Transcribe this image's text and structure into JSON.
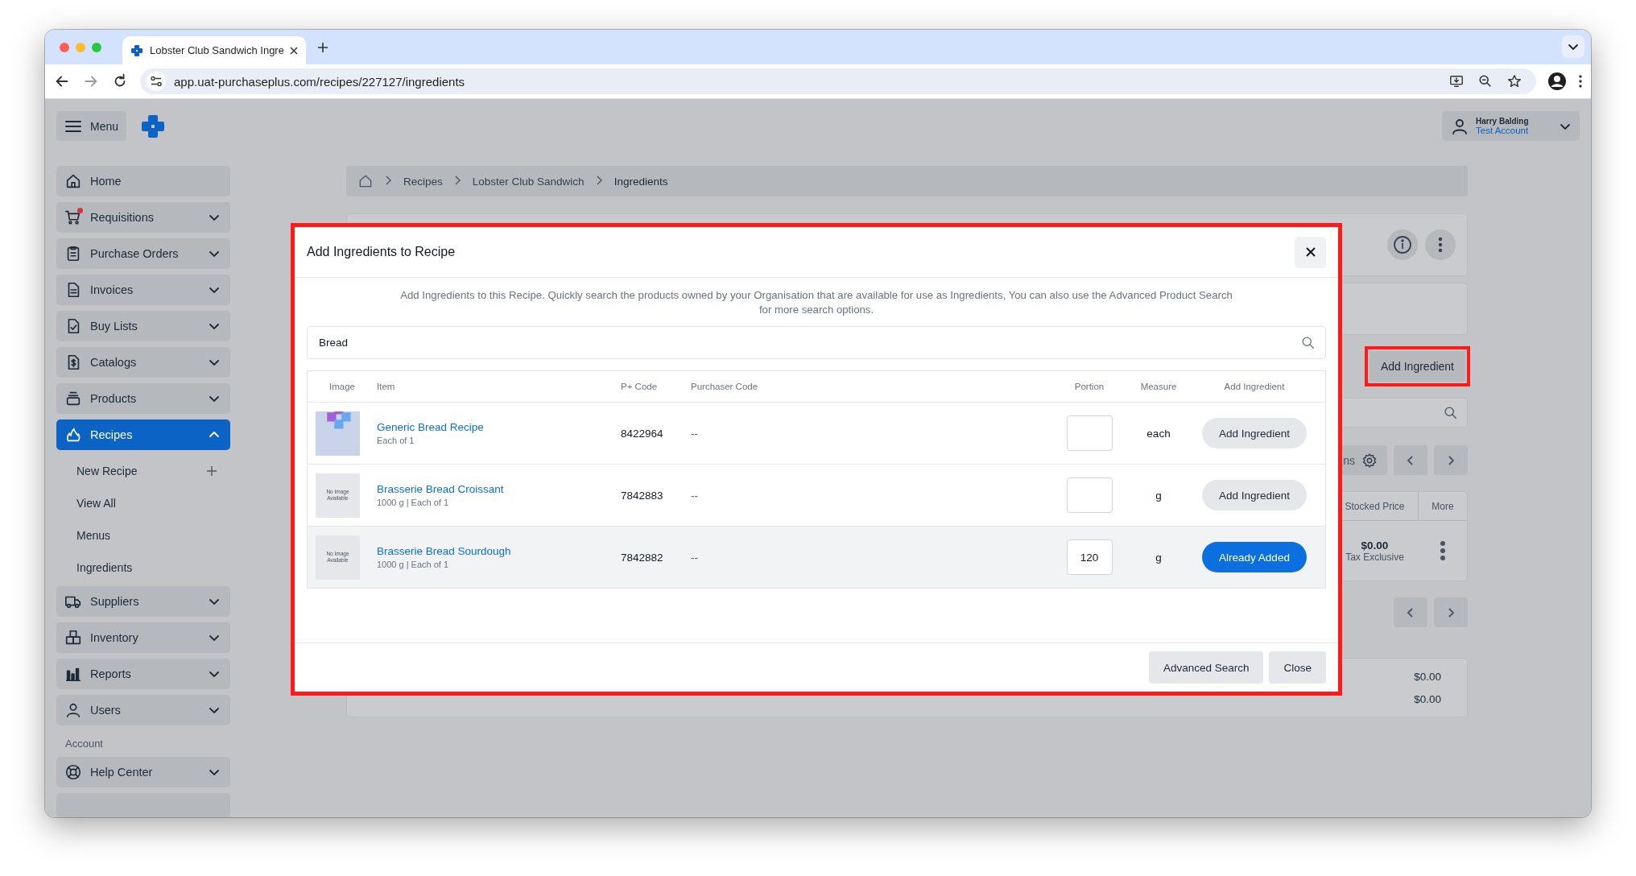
{
  "browser": {
    "tab_title": "Lobster Club Sandwich Ingre",
    "url": "app.uat-purchaseplus.com/recipes/227127/ingredients"
  },
  "header": {
    "menu_label": "Menu",
    "user_name": "Harry Balding",
    "account": "Test Account"
  },
  "sidebar": {
    "items": [
      {
        "label": "Home",
        "kind": "link",
        "selected": false
      },
      {
        "label": "Requisitions",
        "kind": "group",
        "selected": false,
        "expanded": false,
        "alert": true
      },
      {
        "label": "Purchase Orders",
        "kind": "group",
        "selected": false,
        "expanded": false,
        "alert": false
      },
      {
        "label": "Invoices",
        "kind": "group",
        "selected": false,
        "expanded": false,
        "alert": false
      },
      {
        "label": "Buy Lists",
        "kind": "group",
        "selected": false,
        "expanded": false,
        "alert": false
      },
      {
        "label": "Catalogs",
        "kind": "group",
        "selected": false,
        "expanded": false,
        "alert": false
      },
      {
        "label": "Products",
        "kind": "group",
        "selected": false,
        "expanded": false,
        "alert": false
      },
      {
        "label": "Recipes",
        "kind": "group",
        "selected": true,
        "expanded": true,
        "alert": false,
        "children": [
          {
            "label": "New Recipe",
            "kind": "add"
          },
          {
            "label": "View All",
            "kind": "link"
          },
          {
            "label": "Menus",
            "kind": "link"
          },
          {
            "label": "Ingredients",
            "kind": "link"
          }
        ]
      },
      {
        "label": "Suppliers",
        "kind": "group",
        "selected": false,
        "expanded": false,
        "alert": false
      },
      {
        "label": "Inventory",
        "kind": "group",
        "selected": false,
        "expanded": false,
        "alert": false
      },
      {
        "label": "Reports",
        "kind": "group",
        "selected": false,
        "expanded": false,
        "alert": false
      },
      {
        "label": "Users",
        "kind": "group",
        "selected": false,
        "expanded": false,
        "alert": false
      }
    ],
    "account_heading": "Account",
    "account_items": [
      {
        "label": "Help Center",
        "kind": "group",
        "selected": false,
        "expanded": false,
        "alert": false
      }
    ]
  },
  "breadcrumb": [
    "Recipes",
    "Lobster Club Sandwich",
    "Ingredients"
  ],
  "page": {
    "add_button": "Add Ingredient",
    "columns_button": "ns",
    "table_columns": [
      "Stocked Price",
      "More"
    ],
    "row_price": "$0.00",
    "row_note": "Tax Exclusive",
    "totals": [
      "$0.00",
      "$0.00"
    ]
  },
  "modal": {
    "title": "Add Ingredients to Recipe",
    "description": "Add Ingredients to this Recipe. Quickly search the products owned by your Organisation that are available for use as Ingredients, You can also use the Advanced Product Search for more search options.",
    "search": {
      "value": "Bread"
    },
    "columns": [
      "Image",
      "Item",
      "P+ Code",
      "Purchaser Code",
      "Portion",
      "Measure",
      "Add Ingredient"
    ],
    "rows": [
      {
        "kind": "logo",
        "name": "Generic Bread Recipe",
        "detail": "Each of 1",
        "p_code": "8422964",
        "purchaser_code": "--",
        "measure": "each",
        "action": "Add Ingredient",
        "added": false,
        "highlighted": false
      },
      {
        "kind": "placeholder",
        "image_text": "No Image Available",
        "name": "Brasserie Bread Croissant",
        "detail": "1000 g | Each of 1",
        "p_code": "7842883",
        "purchaser_code": "--",
        "measure": "g",
        "action": "Add Ingredient",
        "added": false,
        "highlighted": false
      },
      {
        "kind": "placeholder",
        "image_text": "No Image Available",
        "name": "Brasserie Bread Sourdough",
        "detail": "1000 g | Each of 1",
        "p_code": "7842882",
        "purchaser_code": "--",
        "portion": "120",
        "measure": "g",
        "action": "Already Added",
        "added": true,
        "highlighted": true
      }
    ],
    "buttons": [
      "Advanced Search",
      "Close"
    ]
  }
}
